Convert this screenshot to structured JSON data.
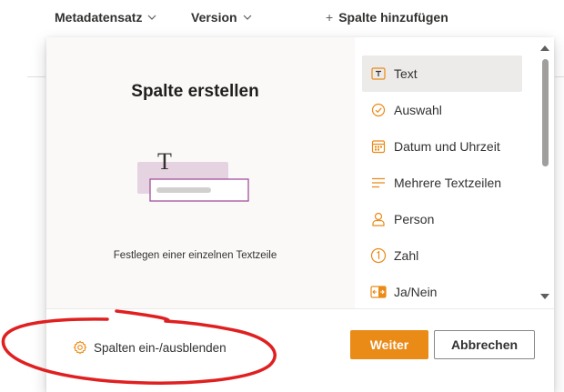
{
  "header": {
    "columns": [
      {
        "label": "Metadatensatz"
      },
      {
        "label": "Version"
      }
    ],
    "add_column_label": "Spalte hinzufügen"
  },
  "panel": {
    "title": "Spalte erstellen",
    "description": "Festlegen einer einzelnen Textzeile",
    "illustration_glyph": "T",
    "types": [
      {
        "label": "Text",
        "icon": "text-icon",
        "selected": true
      },
      {
        "label": "Auswahl",
        "icon": "choice-icon",
        "selected": false
      },
      {
        "label": "Datum und Uhrzeit",
        "icon": "calendar-icon",
        "selected": false
      },
      {
        "label": "Mehrere Textzeilen",
        "icon": "multiline-text-icon",
        "selected": false
      },
      {
        "label": "Person",
        "icon": "person-icon",
        "selected": false
      },
      {
        "label": "Zahl",
        "icon": "number-icon",
        "selected": false
      },
      {
        "label": "Ja/Nein",
        "icon": "yes-no-icon",
        "selected": false
      }
    ]
  },
  "footer": {
    "toggle_columns_label": "Spalten ein-/ausblenden",
    "next_label": "Weiter",
    "cancel_label": "Abbrechen"
  },
  "colors": {
    "accent": "#ea8a17",
    "selected_bg": "#edebe9",
    "annotation": "#e02020",
    "illustration_fill": "#e6d3e1",
    "illustration_border": "#a0509a"
  }
}
